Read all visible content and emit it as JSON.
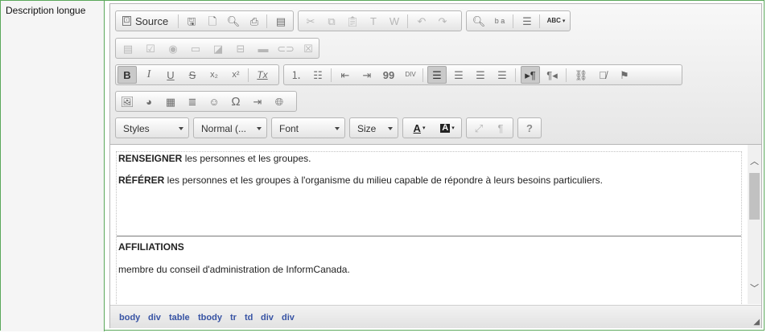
{
  "field": {
    "label": "Description longue"
  },
  "toolbar": {
    "source_label": "Source",
    "styles": "Styles",
    "format": "Normal (...",
    "font": "Font",
    "size": "Size",
    "text_color_glyph": "A",
    "bg_color_glyph": "A",
    "help_glyph": "?",
    "bold_glyph": "B",
    "italic_glyph": "I",
    "underline_glyph": "U",
    "strike_glyph": "S",
    "subscript_glyph": "x₂",
    "superscript_glyph": "x²",
    "removeformat_glyph": "Tx",
    "omega_glyph": "Ω",
    "showblocks_glyph": "¶",
    "spell_glyph": "ABC",
    "replace_glyph": "b a",
    "blockquote_glyph": "99",
    "div_glyph": "DIV"
  },
  "content": {
    "p1_bold": "RENSEIGNER",
    "p1_rest": " les personnes et les groupes.",
    "p2_bold": "RÉFÉRER",
    "p2_rest": " les personnes et les groupes à l'organisme du milieu capable de répondre à leurs besoins particuliers.",
    "heading": "AFFILIATIONS",
    "p3": " membre du conseil d'administration de InformCanada."
  },
  "path": [
    "body",
    "div",
    "table",
    "tbody",
    "tr",
    "td",
    "div",
    "div"
  ],
  "colors": {
    "border_green": "#5ba85b",
    "path_blue": "#3753a4",
    "active_button": "#c9c9c9"
  }
}
